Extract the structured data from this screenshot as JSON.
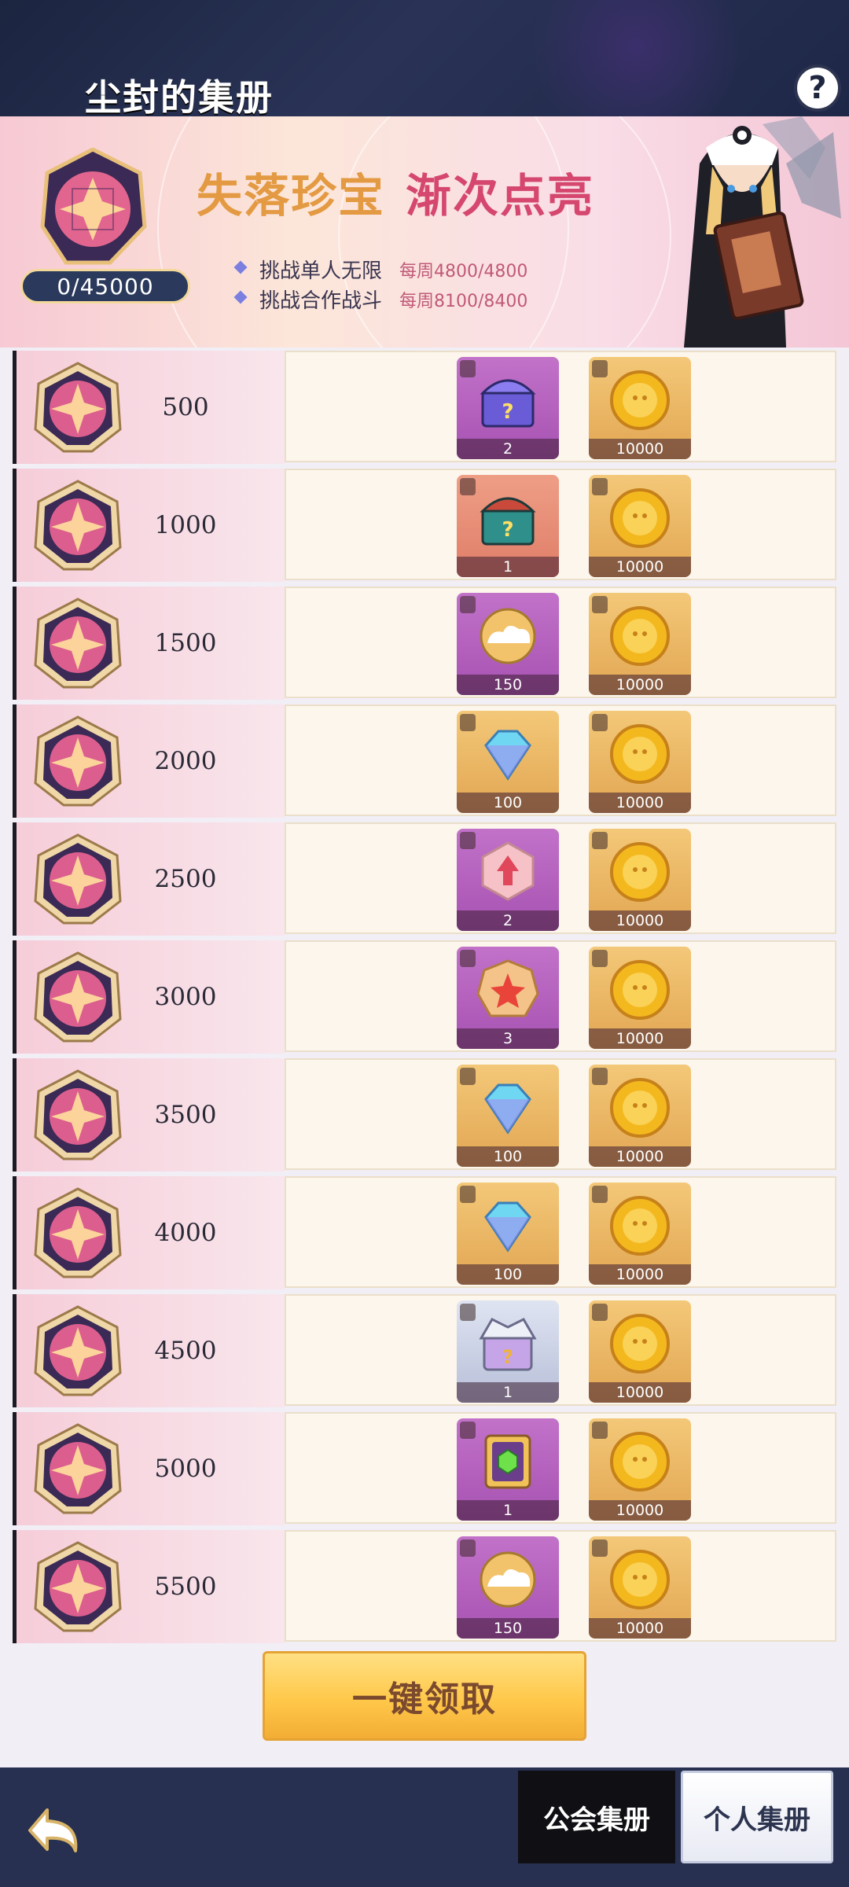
{
  "header": {
    "title": "尘封的集册",
    "help_label": "?"
  },
  "banner": {
    "progress": "0/45000",
    "title_part1": "失落珍宝",
    "title_part2": "渐次点亮",
    "tasks": [
      {
        "label": "挑战单人无限",
        "count": "每周4800/4800"
      },
      {
        "label": "挑战合作战斗",
        "count": "每周8100/8400"
      }
    ]
  },
  "rewards": [
    {
      "threshold": "500",
      "item_icon": "purple-chest-icon",
      "item_bg": "purple",
      "item_qty": "2",
      "coin_qty": "10000"
    },
    {
      "threshold": "1000",
      "item_icon": "red-chest-icon",
      "item_bg": "coral",
      "item_qty": "1",
      "coin_qty": "10000"
    },
    {
      "threshold": "1500",
      "item_icon": "cloud-orb-icon",
      "item_bg": "purple",
      "item_qty": "150",
      "coin_qty": "10000"
    },
    {
      "threshold": "2000",
      "item_icon": "diamond-icon",
      "item_bg": "orange",
      "item_qty": "100",
      "coin_qty": "10000"
    },
    {
      "threshold": "2500",
      "item_icon": "upgrade-badge-icon",
      "item_bg": "purple",
      "item_qty": "2",
      "coin_qty": "10000"
    },
    {
      "threshold": "3000",
      "item_icon": "star-medal-icon",
      "item_bg": "purple",
      "item_qty": "3",
      "coin_qty": "10000"
    },
    {
      "threshold": "3500",
      "item_icon": "diamond-icon",
      "item_bg": "orange",
      "item_qty": "100",
      "coin_qty": "10000"
    },
    {
      "threshold": "4000",
      "item_icon": "diamond-icon",
      "item_bg": "orange",
      "item_qty": "100",
      "coin_qty": "10000"
    },
    {
      "threshold": "4500",
      "item_icon": "silver-chest-icon",
      "item_bg": "silver",
      "item_qty": "1",
      "coin_qty": "10000"
    },
    {
      "threshold": "5000",
      "item_icon": "green-gem-frame-icon",
      "item_bg": "purple",
      "item_qty": "1",
      "coin_qty": "10000"
    },
    {
      "threshold": "5500",
      "item_icon": "cloud-orb-icon",
      "item_bg": "purple",
      "item_qty": "150",
      "coin_qty": "10000"
    }
  ],
  "claim_label": "一键领取",
  "tabs": {
    "guild": "公会集册",
    "personal": "个人集册"
  }
}
